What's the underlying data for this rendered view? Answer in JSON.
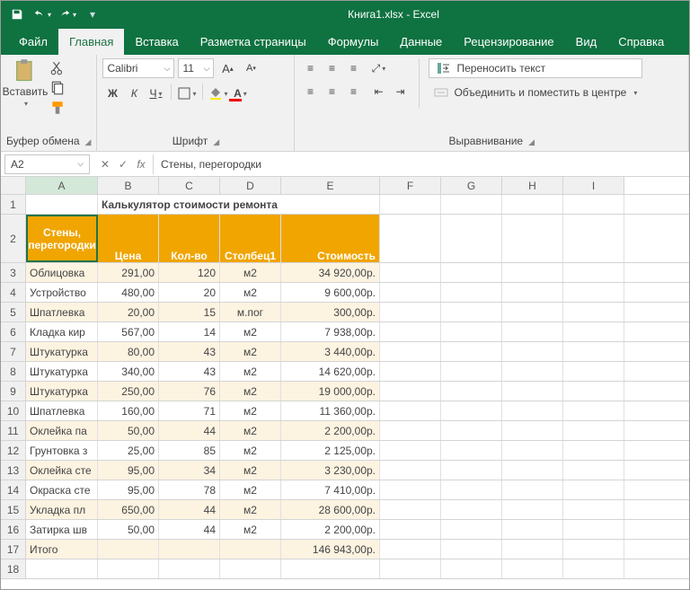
{
  "title": "Книга1.xlsx - Excel",
  "tabs": {
    "file": "Файл",
    "home": "Главная",
    "insert": "Вставка",
    "layout": "Разметка страницы",
    "formulas": "Формулы",
    "data": "Данные",
    "review": "Рецензирование",
    "view": "Вид",
    "help": "Справка"
  },
  "ribbon": {
    "clipboard": {
      "paste": "Вставить",
      "label": "Буфер обмена"
    },
    "font": {
      "name": "Calibri",
      "size": "11",
      "bold": "Ж",
      "italic": "К",
      "underline": "Ч",
      "label": "Шрифт"
    },
    "align": {
      "wrap": "Переносить текст",
      "merge": "Объединить и поместить в центре",
      "label": "Выравнивание"
    }
  },
  "fx": {
    "cell": "A2",
    "formula": "Стены, перегородки",
    "fxSym": "fx"
  },
  "cols": [
    "A",
    "B",
    "C",
    "D",
    "E",
    "F",
    "G",
    "H",
    "I"
  ],
  "header": {
    "title": "Калькулятор стоимости ремонта",
    "a": "Стены, перегородки",
    "b": "Цена",
    "c": "Кол-во",
    "d": "Столбец1",
    "e": "Стоимость"
  },
  "rows": [
    {
      "n": "3",
      "a": "Облицовка",
      "b": "291,00",
      "c": "120",
      "d": "м2",
      "e": "34 920,00р."
    },
    {
      "n": "4",
      "a": "Устройство",
      "b": "480,00",
      "c": "20",
      "d": "м2",
      "e": "9 600,00р."
    },
    {
      "n": "5",
      "a": "Шпатлевка",
      "b": "20,00",
      "c": "15",
      "d": "м.пог",
      "e": "300,00р."
    },
    {
      "n": "6",
      "a": "Кладка кир",
      "b": "567,00",
      "c": "14",
      "d": "м2",
      "e": "7 938,00р."
    },
    {
      "n": "7",
      "a": "Штукатурка",
      "b": "80,00",
      "c": "43",
      "d": "м2",
      "e": "3 440,00р."
    },
    {
      "n": "8",
      "a": "Штукатурка",
      "b": "340,00",
      "c": "43",
      "d": "м2",
      "e": "14 620,00р."
    },
    {
      "n": "9",
      "a": "Штукатурка",
      "b": "250,00",
      "c": "76",
      "d": "м2",
      "e": "19 000,00р."
    },
    {
      "n": "10",
      "a": "Шпатлевка",
      "b": "160,00",
      "c": "71",
      "d": "м2",
      "e": "11 360,00р."
    },
    {
      "n": "11",
      "a": "Оклейка па",
      "b": "50,00",
      "c": "44",
      "d": "м2",
      "e": "2 200,00р."
    },
    {
      "n": "12",
      "a": "Грунтовка з",
      "b": "25,00",
      "c": "85",
      "d": "м2",
      "e": "2 125,00р."
    },
    {
      "n": "13",
      "a": "Оклейка сте",
      "b": "95,00",
      "c": "34",
      "d": "м2",
      "e": "3 230,00р."
    },
    {
      "n": "14",
      "a": "Окраска сте",
      "b": "95,00",
      "c": "78",
      "d": "м2",
      "e": "7 410,00р."
    },
    {
      "n": "15",
      "a": "Укладка пл",
      "b": "650,00",
      "c": "44",
      "d": "м2",
      "e": "28 600,00р."
    },
    {
      "n": "16",
      "a": "Затирка шв",
      "b": "50,00",
      "c": "44",
      "d": "м2",
      "e": "2 200,00р."
    },
    {
      "n": "17",
      "a": "Итого",
      "b": "",
      "c": "",
      "d": "",
      "e": "146 943,00р."
    }
  ],
  "chart_data": {
    "type": "table",
    "title": "Калькулятор стоимости ремонта",
    "columns": [
      "Стены, перегородки",
      "Цена",
      "Кол-во",
      "Столбец1",
      "Стоимость"
    ],
    "rows": [
      [
        "Облицовка",
        291.0,
        120,
        "м2",
        34920.0
      ],
      [
        "Устройство",
        480.0,
        20,
        "м2",
        9600.0
      ],
      [
        "Шпатлевка",
        20.0,
        15,
        "м.пог",
        300.0
      ],
      [
        "Кладка кир",
        567.0,
        14,
        "м2",
        7938.0
      ],
      [
        "Штукатурка",
        80.0,
        43,
        "м2",
        3440.0
      ],
      [
        "Штукатурка",
        340.0,
        43,
        "м2",
        14620.0
      ],
      [
        "Штукатурка",
        250.0,
        76,
        "м2",
        19000.0
      ],
      [
        "Шпатлевка",
        160.0,
        71,
        "м2",
        11360.0
      ],
      [
        "Оклейка па",
        50.0,
        44,
        "м2",
        2200.0
      ],
      [
        "Грунтовка з",
        25.0,
        85,
        "м2",
        2125.0
      ],
      [
        "Оклейка сте",
        95.0,
        34,
        "м2",
        3230.0
      ],
      [
        "Окраска сте",
        95.0,
        78,
        "м2",
        7410.0
      ],
      [
        "Укладка пл",
        650.0,
        44,
        "м2",
        28600.0
      ],
      [
        "Затирка шв",
        50.0,
        44,
        "м2",
        2200.0
      ]
    ],
    "total": 146943.0
  }
}
